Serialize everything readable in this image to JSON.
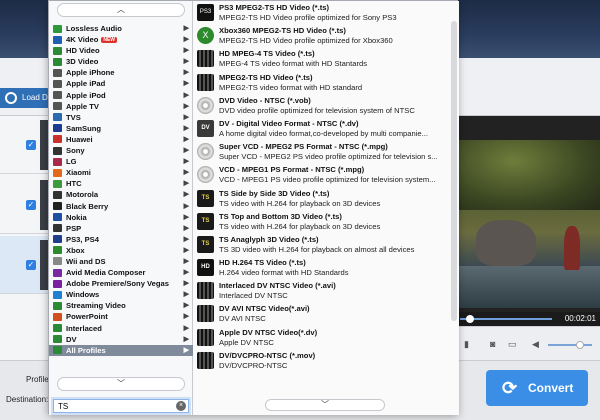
{
  "app": {
    "load_label": "Load D",
    "profile_label": "Profile:",
    "destination_label": "Destination:",
    "convert_label": "Convert",
    "time": "00:02:01"
  },
  "categories": [
    {
      "label": "Lossless Audio",
      "icon": "audio-note-icon",
      "color": "#2c9a3a"
    },
    {
      "label": "4K Video",
      "icon": "4k-icon",
      "color": "#1f5fb0",
      "badge": "NEW"
    },
    {
      "label": "HD Video",
      "icon": "hd-icon",
      "color": "#2b8a36"
    },
    {
      "label": "3D Video",
      "icon": "3d-icon",
      "color": "#2b8a36"
    },
    {
      "label": "Apple iPhone",
      "icon": "apple-icon",
      "color": "#555555"
    },
    {
      "label": "Apple iPad",
      "icon": "apple-icon",
      "color": "#555555"
    },
    {
      "label": "Apple iPod",
      "icon": "apple-icon",
      "color": "#555555"
    },
    {
      "label": "Apple TV",
      "icon": "apple-icon",
      "color": "#555555"
    },
    {
      "label": "TVS",
      "icon": "tv-icon",
      "color": "#2b6ab0"
    },
    {
      "label": "SamSung",
      "icon": "samsung-icon",
      "color": "#1d3b8f"
    },
    {
      "label": "Huawei",
      "icon": "huawei-icon",
      "color": "#c9312d"
    },
    {
      "label": "Sony",
      "icon": "sony-icon",
      "color": "#333333"
    },
    {
      "label": "LG",
      "icon": "lg-icon",
      "color": "#a82a4a"
    },
    {
      "label": "Xiaomi",
      "icon": "xiaomi-icon",
      "color": "#e36a1a"
    },
    {
      "label": "HTC",
      "icon": "htc-icon",
      "color": "#3d9a3d"
    },
    {
      "label": "Motorola",
      "icon": "motorola-icon",
      "color": "#333333"
    },
    {
      "label": "Black Berry",
      "icon": "blackberry-icon",
      "color": "#222222"
    },
    {
      "label": "Nokia",
      "icon": "nokia-icon",
      "color": "#1f4fa0"
    },
    {
      "label": "PSP",
      "icon": "psp-icon",
      "color": "#333333"
    },
    {
      "label": "PS3, PS4",
      "icon": "playstation-icon",
      "color": "#1f3f8a"
    },
    {
      "label": "Xbox",
      "icon": "xbox-icon",
      "color": "#2d8a2d"
    },
    {
      "label": "Wii and DS",
      "icon": "wii-icon",
      "color": "#888888"
    },
    {
      "label": "Avid Media Composer",
      "icon": "avid-icon",
      "color": "#7a2aa0"
    },
    {
      "label": "Adobe Premiere/Sony Vegas",
      "icon": "adobe-icon",
      "color": "#7a1fa0"
    },
    {
      "label": "Windows",
      "icon": "windows-icon",
      "color": "#1f7fd0"
    },
    {
      "label": "Streaming Video",
      "icon": "streaming-icon",
      "color": "#2b8a36"
    },
    {
      "label": "PowerPoint",
      "icon": "powerpoint-icon",
      "color": "#d2501f"
    },
    {
      "label": "Interlaced",
      "icon": "interlaced-icon",
      "color": "#2b8a36"
    },
    {
      "label": "DV",
      "icon": "dv-icon",
      "color": "#2b8a36"
    },
    {
      "label": "All Profiles",
      "icon": "all-profiles-icon",
      "color": "#2b8a36",
      "selected": true
    }
  ],
  "profiles": [
    {
      "title": "PS3 MPEG2-TS HD Video (*.ts)",
      "desc": "MPEG2-TS HD Video profile optimized for Sony PS3",
      "icon": "ps3-icon",
      "kind": "ps3",
      "glyph": "PS3"
    },
    {
      "title": "Xbox360 MPEG2-TS HD Video (*.ts)",
      "desc": "MPEG2-TS HD Video profile optimized for Xbox360",
      "icon": "xbox-icon",
      "kind": "xbox",
      "glyph": "X"
    },
    {
      "title": "HD MPEG-4 TS Video (*.ts)",
      "desc": "MPEG-4 TS video format with HD Stantards",
      "icon": "film-strip-icon",
      "kind": "film",
      "glyph": ""
    },
    {
      "title": "MPEG2-TS HD Video (*.ts)",
      "desc": "MPEG2-TS video format with HD standard",
      "icon": "film-strip-icon",
      "kind": "film",
      "glyph": ""
    },
    {
      "title": "DVD Video - NTSC (*.vob)",
      "desc": "DVD video profile optimized for television system of NTSC",
      "icon": "disc-icon",
      "kind": "disc",
      "glyph": ""
    },
    {
      "title": "DV - Digital Video Format - NTSC (*.dv)",
      "desc": "A home digital video format,co-developed by multi companie...",
      "icon": "dv-icon",
      "kind": "dv",
      "glyph": "DV"
    },
    {
      "title": "Super VCD - MPEG2 PS Format - NTSC (*.mpg)",
      "desc": "Super VCD - MPEG2 PS video profile optimized for television s...",
      "icon": "disc-icon",
      "kind": "disc",
      "glyph": ""
    },
    {
      "title": "VCD - MPEG1 PS Format - NTSC (*.mpg)",
      "desc": "VCD - MPEG1 PS video profile optimized for television system...",
      "icon": "disc-icon",
      "kind": "disc",
      "glyph": ""
    },
    {
      "title": "TS Side by Side 3D Video (*.ts)",
      "desc": "TS video with H.264 for playback on 3D devices",
      "icon": "ts-3d-icon",
      "kind": "ts",
      "glyph": "TS"
    },
    {
      "title": "TS Top and Bottom 3D Video (*.ts)",
      "desc": "TS video with H.264 for playback on 3D devices",
      "icon": "ts-3d-icon",
      "kind": "ts",
      "glyph": "TS"
    },
    {
      "title": "TS Anaglyph 3D Video (*.ts)",
      "desc": "TS 3D video with H.264 for playback on almost all devices",
      "icon": "ts-3d-icon",
      "kind": "ts",
      "glyph": "TS"
    },
    {
      "title": "HD H.264 TS Video (*.ts)",
      "desc": "H.264 video format with HD Standards",
      "icon": "hd-icon",
      "kind": "hd",
      "glyph": "HD"
    },
    {
      "title": "Interlaced DV NTSC Video (*.avi)",
      "desc": "Interlaced DV NTSC",
      "icon": "film-strip-icon",
      "kind": "film",
      "glyph": ""
    },
    {
      "title": "DV AVI NTSC Video(*.avi)",
      "desc": "DV AVI NTSC",
      "icon": "film-strip-icon",
      "kind": "film",
      "glyph": ""
    },
    {
      "title": "Apple DV NTSC Video(*.dv)",
      "desc": "Apple DV NTSC",
      "icon": "film-strip-icon",
      "kind": "film",
      "glyph": ""
    },
    {
      "title": "DV/DVCPRO-NTSC (*.mov)",
      "desc": "DV/DVCPRO-NTSC",
      "icon": "film-strip-icon",
      "kind": "film",
      "glyph": ""
    }
  ],
  "search": {
    "value": "TS",
    "placeholder": ""
  },
  "glyphs": {
    "up": "︿",
    "down": "﹀",
    "arrow": "▶",
    "clear": "×",
    "convert": "⟳",
    "check": "✓"
  }
}
